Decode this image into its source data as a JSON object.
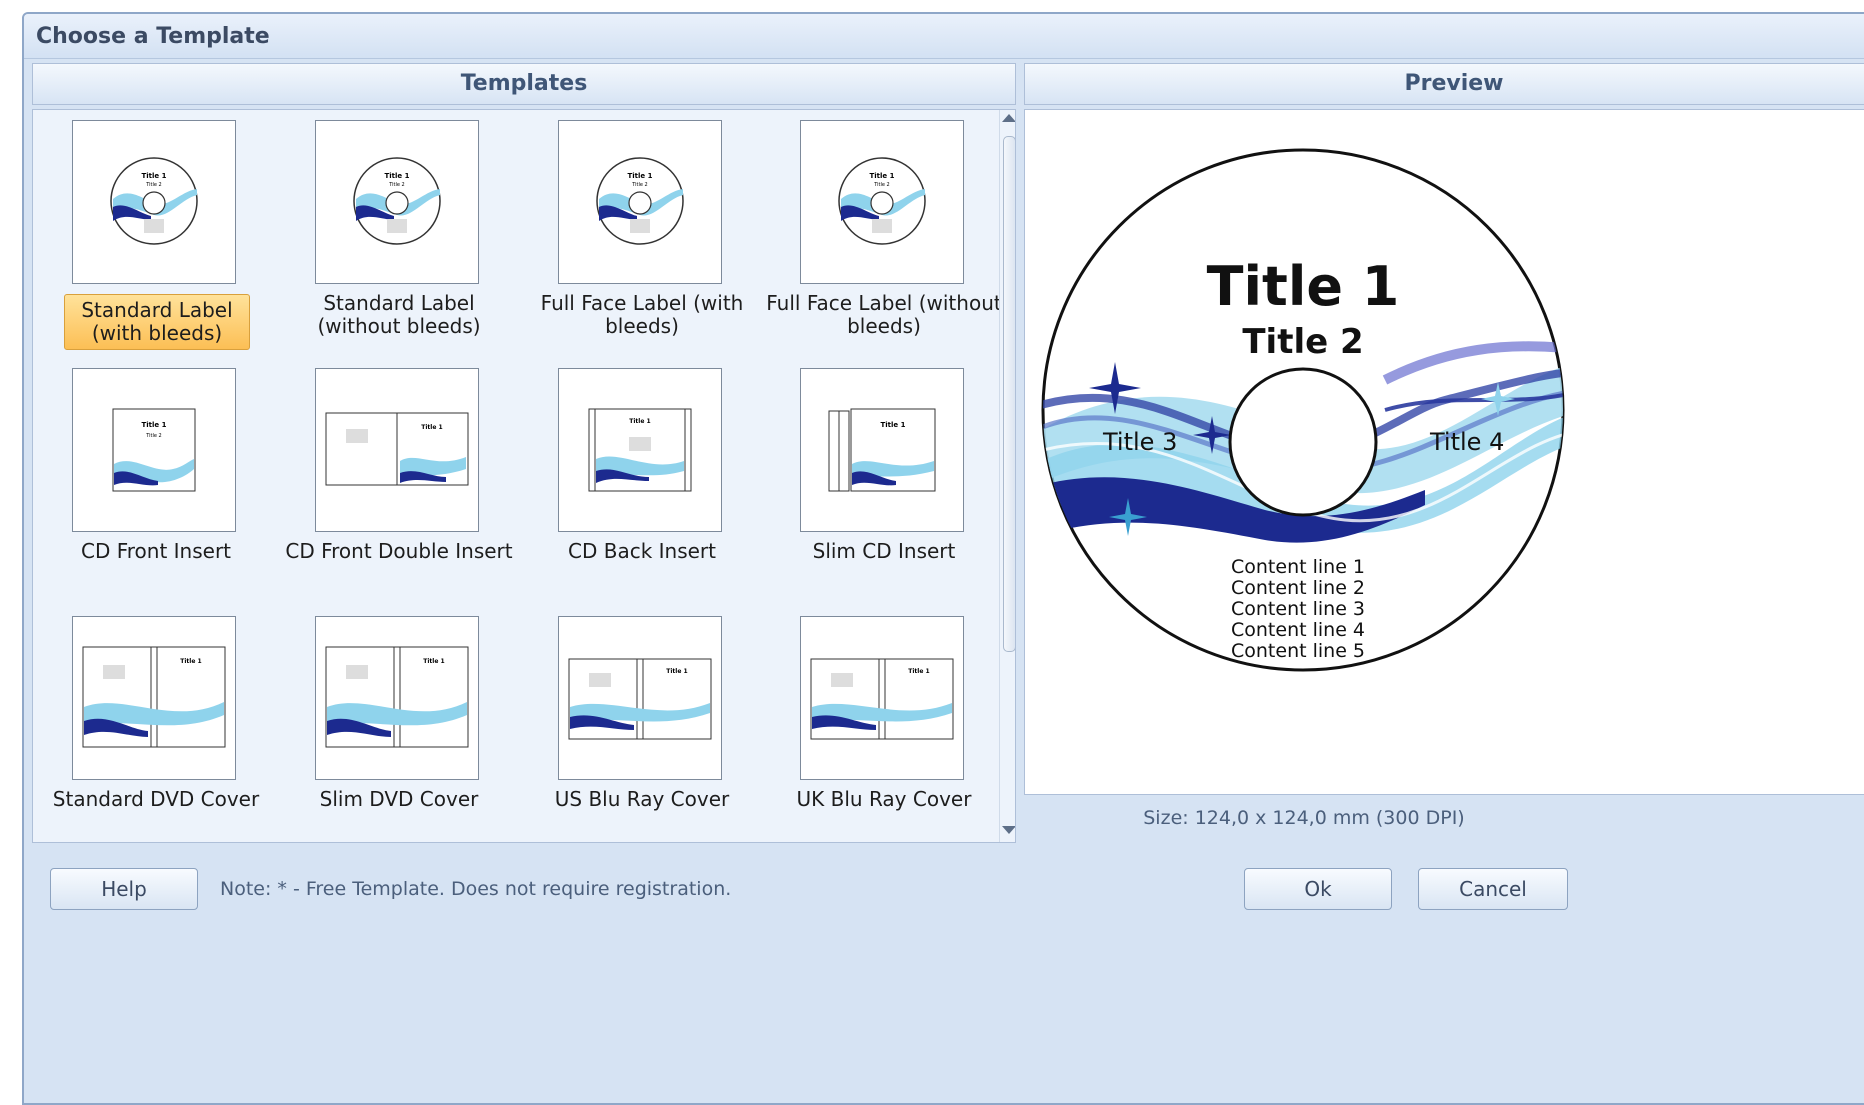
{
  "window": {
    "title": "Choose a Template"
  },
  "templates_panel": {
    "header": "Templates",
    "items": [
      {
        "label": "Standard Label (with bleeds)",
        "thumb": "disc",
        "selected": true
      },
      {
        "label": "Standard Label (without bleeds)",
        "thumb": "disc",
        "selected": false
      },
      {
        "label": "Full Face Label (with bleeds)",
        "thumb": "disc",
        "selected": false
      },
      {
        "label": "Full Face Label (without bleeds)",
        "thumb": "disc",
        "selected": false
      },
      {
        "label": "CD Front Insert",
        "thumb": "front-insert",
        "selected": false
      },
      {
        "label": "CD Front Double Insert",
        "thumb": "double-insert",
        "selected": false
      },
      {
        "label": "CD Back Insert",
        "thumb": "back-insert",
        "selected": false
      },
      {
        "label": "Slim CD Insert",
        "thumb": "slim-insert",
        "selected": false
      },
      {
        "label": "Standard DVD Cover",
        "thumb": "dvd-cover",
        "selected": false
      },
      {
        "label": "Slim DVD Cover",
        "thumb": "dvd-cover",
        "selected": false
      },
      {
        "label": "US Blu Ray Cover",
        "thumb": "bluray-cover",
        "selected": false
      },
      {
        "label": "UK Blu Ray Cover",
        "thumb": "bluray-cover",
        "selected": false
      }
    ]
  },
  "preview_panel": {
    "header": "Preview",
    "title1": "Title 1",
    "title2": "Title 2",
    "title3": "Title 3",
    "title4": "Title 4",
    "content_lines": [
      "Content line 1",
      "Content line 2",
      "Content line 3",
      "Content line 4",
      "Content line 5"
    ],
    "size_text": "Size: 124,0 x 124,0 mm (300 DPI)"
  },
  "footer": {
    "help_label": "Help",
    "note": "Note: * - Free Template. Does not require registration.",
    "ok_label": "Ok",
    "cancel_label": "Cancel"
  },
  "colors": {
    "wave_dark": "#1c2a8f",
    "wave_light": "#8fd3ec",
    "selection": "#fcbf55",
    "dialog_bg": "#d6e3f3"
  }
}
